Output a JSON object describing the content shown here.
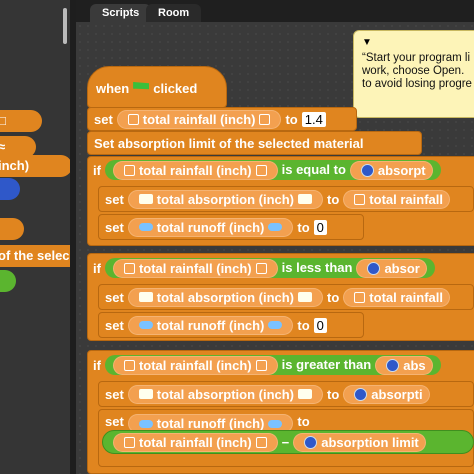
{
  "tabs": [
    {
      "label": "Scripts",
      "active": true
    },
    {
      "label": "Room",
      "active": false
    }
  ],
  "note": {
    "lines": [
      "“Start your program li",
      "work, choose Open.",
      "to avoid losing progre"
    ]
  },
  "palette": {
    "items": [
      "□",
      "≈",
      "inch)",
      "",
      "",
      "of the selec",
      ""
    ]
  },
  "script": {
    "hat": {
      "label": "when",
      "suffix": "clicked"
    },
    "set_rainfall": {
      "keyword": "set",
      "var": "total rainfall (inch)",
      "to": "to",
      "value": "1.4"
    },
    "set_absorption_limit": {
      "label": "Set absorption limit of the selected material"
    },
    "if1": {
      "keyword": "if",
      "left": "total rainfall (inch)",
      "op": "is equal to",
      "right": "absorpt"
    },
    "if1_set_abs": {
      "keyword": "set",
      "var": "total absorption (inch)",
      "to": "to",
      "value": "total rainfall"
    },
    "if1_set_runoff": {
      "keyword": "set",
      "var": "total runoff (inch)",
      "to": "to",
      "value": "0"
    },
    "if2": {
      "keyword": "if",
      "left": "total rainfall (inch)",
      "op": "is less than",
      "right": "absor"
    },
    "if2_set_abs": {
      "keyword": "set",
      "var": "total absorption (inch)",
      "to": "to",
      "value": "total rainfall"
    },
    "if2_set_runoff": {
      "keyword": "set",
      "var": "total runoff (inch)",
      "to": "to",
      "value": "0"
    },
    "if3": {
      "keyword": "if",
      "left": "total rainfall (inch)",
      "op": "is greater than",
      "right": "abs"
    },
    "if3_set_abs": {
      "keyword": "set",
      "var": "total absorption (inch)",
      "to": "to",
      "value": "absorpti"
    },
    "if3_set_runoff": {
      "keyword": "set",
      "var": "total runoff (inch)",
      "to": "to"
    },
    "if3_expr": {
      "left": "total rainfall (inch)",
      "op": "−",
      "right": "absorption limit"
    }
  }
}
